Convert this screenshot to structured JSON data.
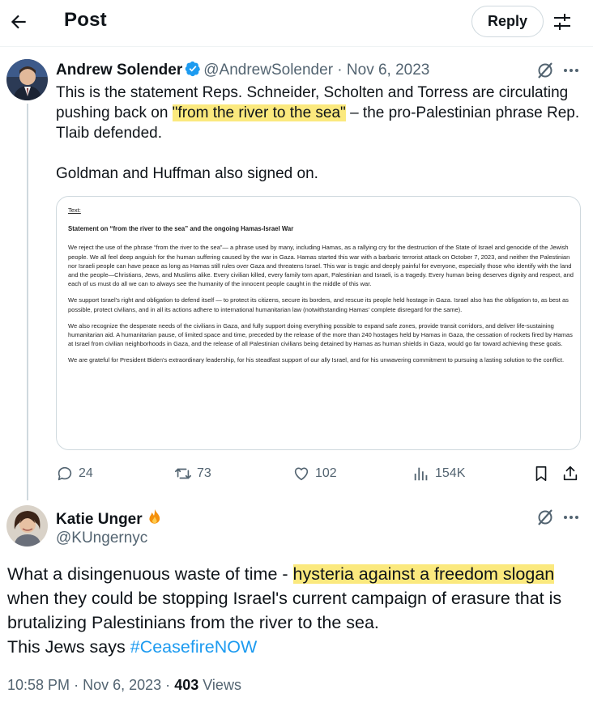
{
  "header": {
    "title": "Post",
    "reply_label": "Reply"
  },
  "tweet1": {
    "author_name": "Andrew Solender",
    "handle": "@AndrewSolender",
    "separator": "·",
    "date": "Nov 6, 2023",
    "text_part1": "This is the statement Reps. Schneider, Scholten and Torress are circulating pushing back on ",
    "text_highlight": "\"from the river to the sea\"",
    "text_part2": " – the pro-Palestinian phrase Rep. Tlaib defended.",
    "text_para2": "Goldman and Huffman also signed on.",
    "image": {
      "label": "Text:",
      "title": "Statement on “from the river to the sea” and the ongoing Hamas-Israel War",
      "p1": "We reject the use of the phrase “from the river to the sea”— a phrase used by many, including Hamas, as a rallying cry for the destruction of the State of Israel and genocide of the Jewish people. We all feel deep anguish for the human suffering caused by the war in Gaza. Hamas started this war with a barbaric terrorist attack on October 7, 2023, and neither the Palestinian nor Israeli people can have peace as long as Hamas still rules over Gaza and threatens Israel. This war is tragic and deeply painful for everyone, especially those who identify with the land and the people—Christians, Jews, and Muslims alike. Every civilian killed, every family torn apart, Palestinian and Israeli, is a tragedy. Every human being deserves dignity and respect, and each of us must do all we can to always see the humanity of the innocent people caught in the middle of this war.",
      "p2": "We support Israel's right and obligation to defend itself — to protect its citizens, secure its borders, and rescue its people held hostage in Gaza. Israel also has the obligation to, as best as possible, protect civilians, and in all its actions adhere to international humanitarian law (notwithstanding Hamas' complete disregard for the same).",
      "p3": "We also recognize the desperate needs of the civilians in Gaza, and fully support doing everything possible to expand safe zones, provide transit corridors, and deliver life-sustaining humanitarian aid. A humanitarian pause, of limited space and time, preceded by the release of the more than 240 hostages held by Hamas in Gaza, the cessation of rockets fired by Hamas at Israel from civilian neighborhoods in Gaza, and the release of all Palestinian civilians being detained by Hamas as human shields in Gaza, would go far toward achieving these goals.",
      "p4": "We are grateful for President Biden's extraordinary leadership, for his steadfast support of our ally Israel, and for his unwavering commitment to pursuing a lasting solution to the conflict."
    },
    "stats": {
      "replies": "24",
      "reposts": "73",
      "likes": "102",
      "views": "154K"
    }
  },
  "tweet2": {
    "author_name": "Katie Unger",
    "handle": "@KUngernyc",
    "text_part1": "What a disingenuous waste of time - ",
    "text_highlight": "hysteria against a freedom slogan",
    "text_part2": " when they could be stopping Israel's current campaign of erasure that is brutalizing Palestinians from the river to the sea.",
    "text_line2": "This Jews says ",
    "hashtag": "#CeasefireNOW",
    "time": "10:58 PM",
    "dot": "·",
    "date": "Nov 6, 2023",
    "views_count": "403",
    "views_label": "Views"
  },
  "colors": {
    "text": "#0f1419",
    "muted": "#536471",
    "highlight": "#fbe97e",
    "link": "#1d9bf0",
    "verified": "#1d9bf0"
  }
}
